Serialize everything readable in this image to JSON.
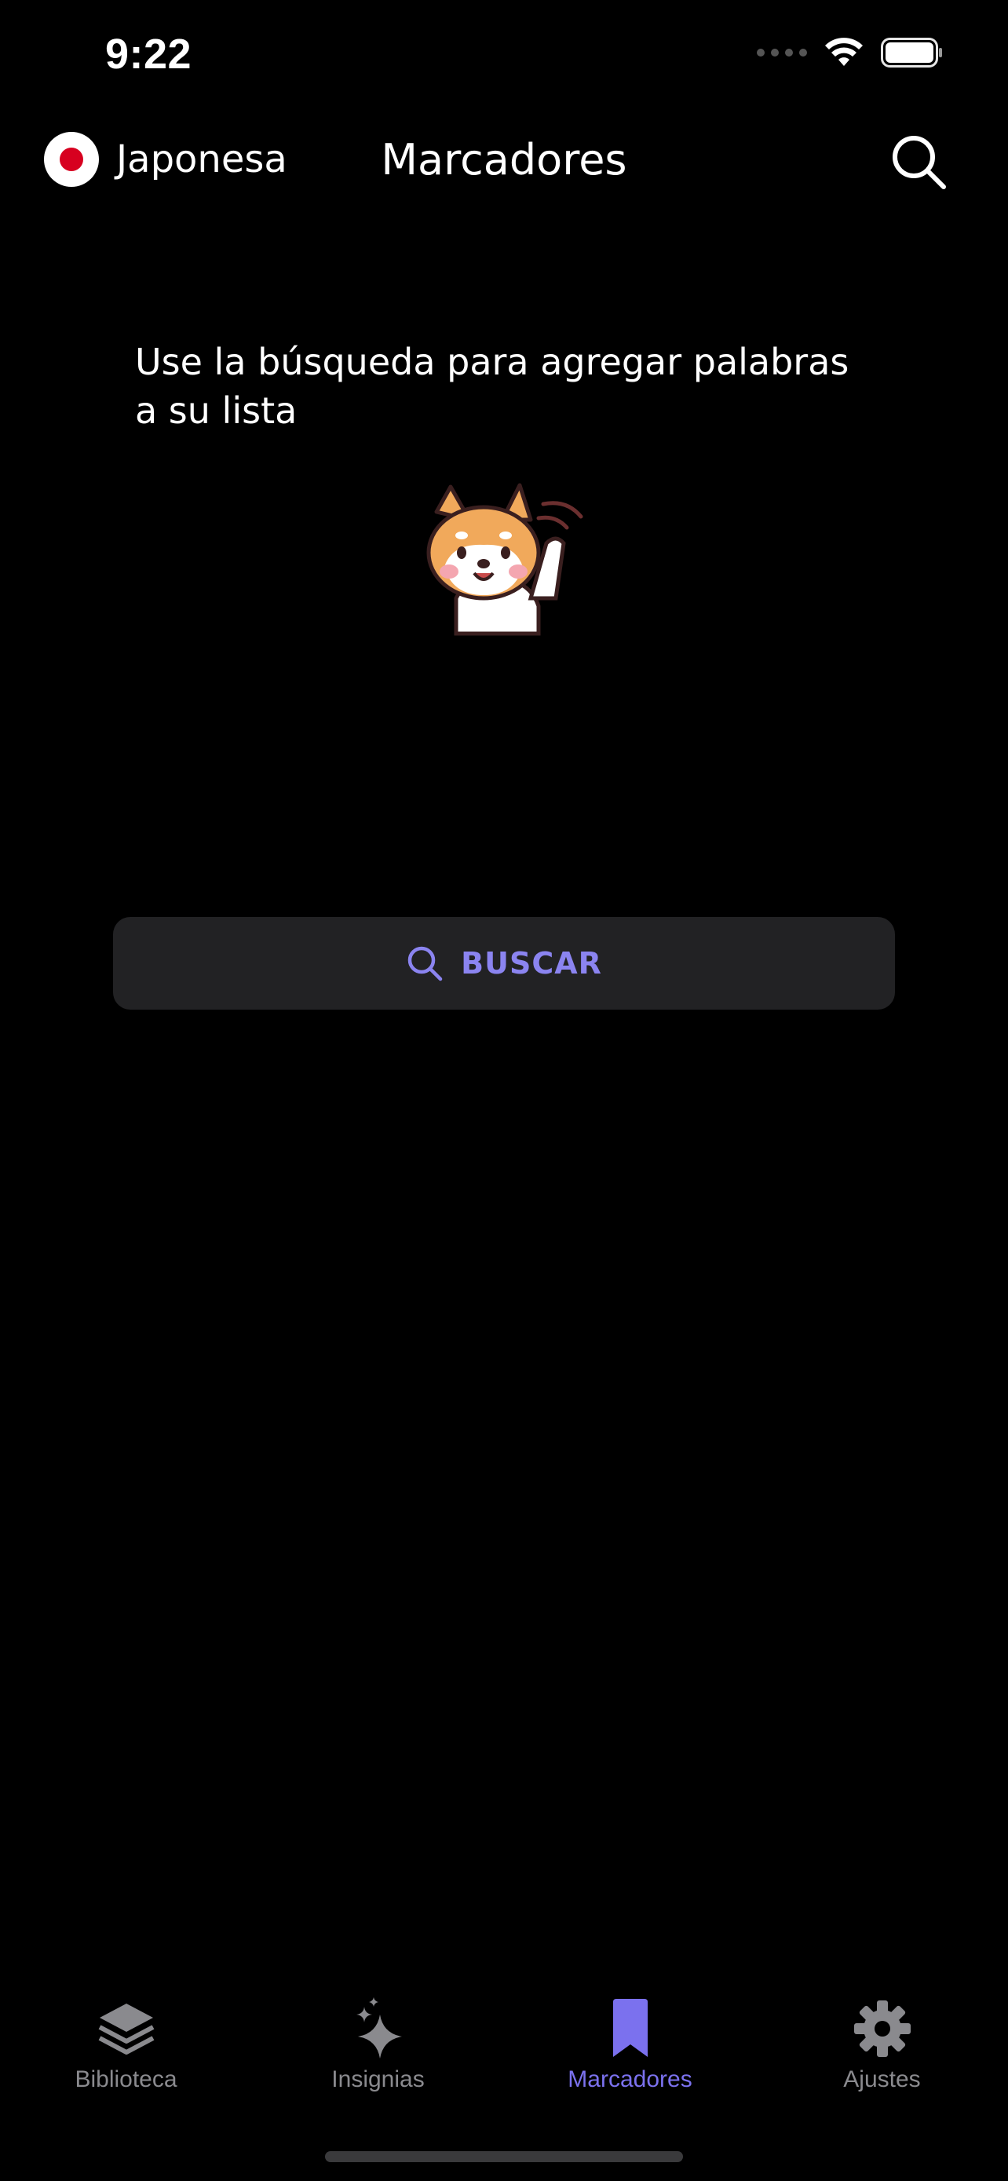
{
  "status_bar": {
    "time": "9:22"
  },
  "header": {
    "language_label": "Japonesa",
    "title": "Marcadores"
  },
  "main": {
    "empty_message": "Use la búsqueda para agregar palabras a su lista",
    "search_button_label": "BUSCAR"
  },
  "tabbar": {
    "items": [
      {
        "label": "Biblioteca",
        "icon": "stack-icon",
        "active": false
      },
      {
        "label": "Insignias",
        "icon": "sparkle-icon",
        "active": false
      },
      {
        "label": "Marcadores",
        "icon": "bookmark-icon",
        "active": true
      },
      {
        "label": "Ajustes",
        "icon": "gear-icon",
        "active": false
      }
    ]
  },
  "colors": {
    "accent": "#7b71ee",
    "button_text": "#8b84f0",
    "inactive": "#8a8a8e",
    "background": "#000000",
    "button_bg": "#222224"
  }
}
